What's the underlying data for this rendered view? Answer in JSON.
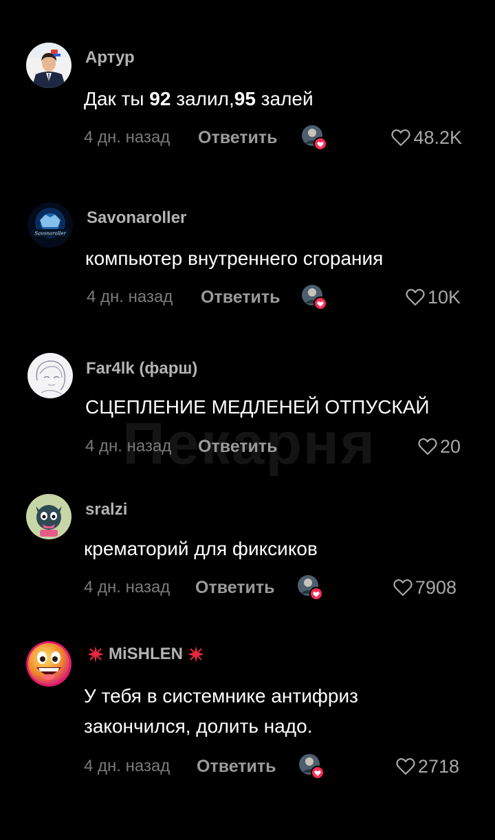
{
  "watermark": "Пекарня",
  "icons": {
    "like": "heart-outline-icon",
    "creator_like": "creator-avatar-with-heart-icon",
    "badge_decoration": "sparkle-icon"
  },
  "colors": {
    "background": "#000000",
    "text": "#ffffff",
    "username": "#b3b3b3",
    "meta": "#7a7a7a",
    "reply": "#9b9b9b",
    "heart_badge": "#fe2c55",
    "sparkle": "#e8273e"
  },
  "comments": [
    {
      "username": "Артур",
      "text_parts": [
        "Дак ты ",
        "92",
        " залил,",
        "95",
        " залей"
      ],
      "time": "4 дн. назад",
      "reply_label": "Ответить",
      "likes": "48.2K"
    },
    {
      "username": "Savonaroller",
      "avatar_text": "Savonaroller",
      "text": "компьютер внутреннего сгорания",
      "time": "4 дн. назад",
      "reply_label": "Ответить",
      "likes": "10K"
    },
    {
      "username": "Far4lk (фарш)",
      "text": "СЦЕПЛЕНИЕ МЕДЛЕНЕЙ ОТПУСКАЙ",
      "time": "4 дн. назад",
      "reply_label": "Ответить",
      "likes": "20"
    },
    {
      "username": "sralzi",
      "text": "крематорий для фиксиков",
      "time": "4 дн. назад",
      "reply_label": "Ответить",
      "likes": "7908"
    },
    {
      "username": "MiSHLEN",
      "text_lines": [
        "У тебя в системнике антифриз",
        "закончился, долить надо."
      ],
      "time": "4 дн. назад",
      "reply_label": "Ответить",
      "likes": "2718"
    }
  ]
}
